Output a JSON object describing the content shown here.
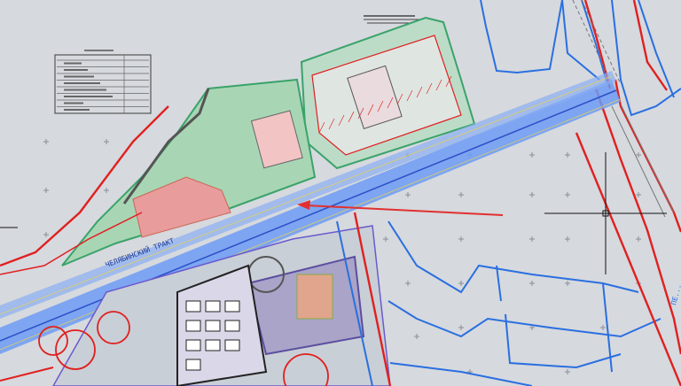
{
  "app": {
    "view": "cad-drawing-viewport",
    "background_color": "#d6d9de"
  },
  "drawing": {
    "road_label": "ЧЕЛЯБИНСКИЙ ТРАКТ",
    "edge_label": "ПЕ...",
    "legend_title": "",
    "stamp_title": "",
    "colors": {
      "site_green": "#6fbf8c",
      "red_line": "#e02020",
      "blue_line": "#2a6fe0",
      "road_band": "#5b8ff0",
      "building_pink": "#e8a0a0",
      "arrow": "#e23030"
    }
  },
  "crosshair": {
    "cursor_icon": "crosshair-icon"
  },
  "annotation_arrow": {
    "icon": "arrow-left-icon"
  }
}
